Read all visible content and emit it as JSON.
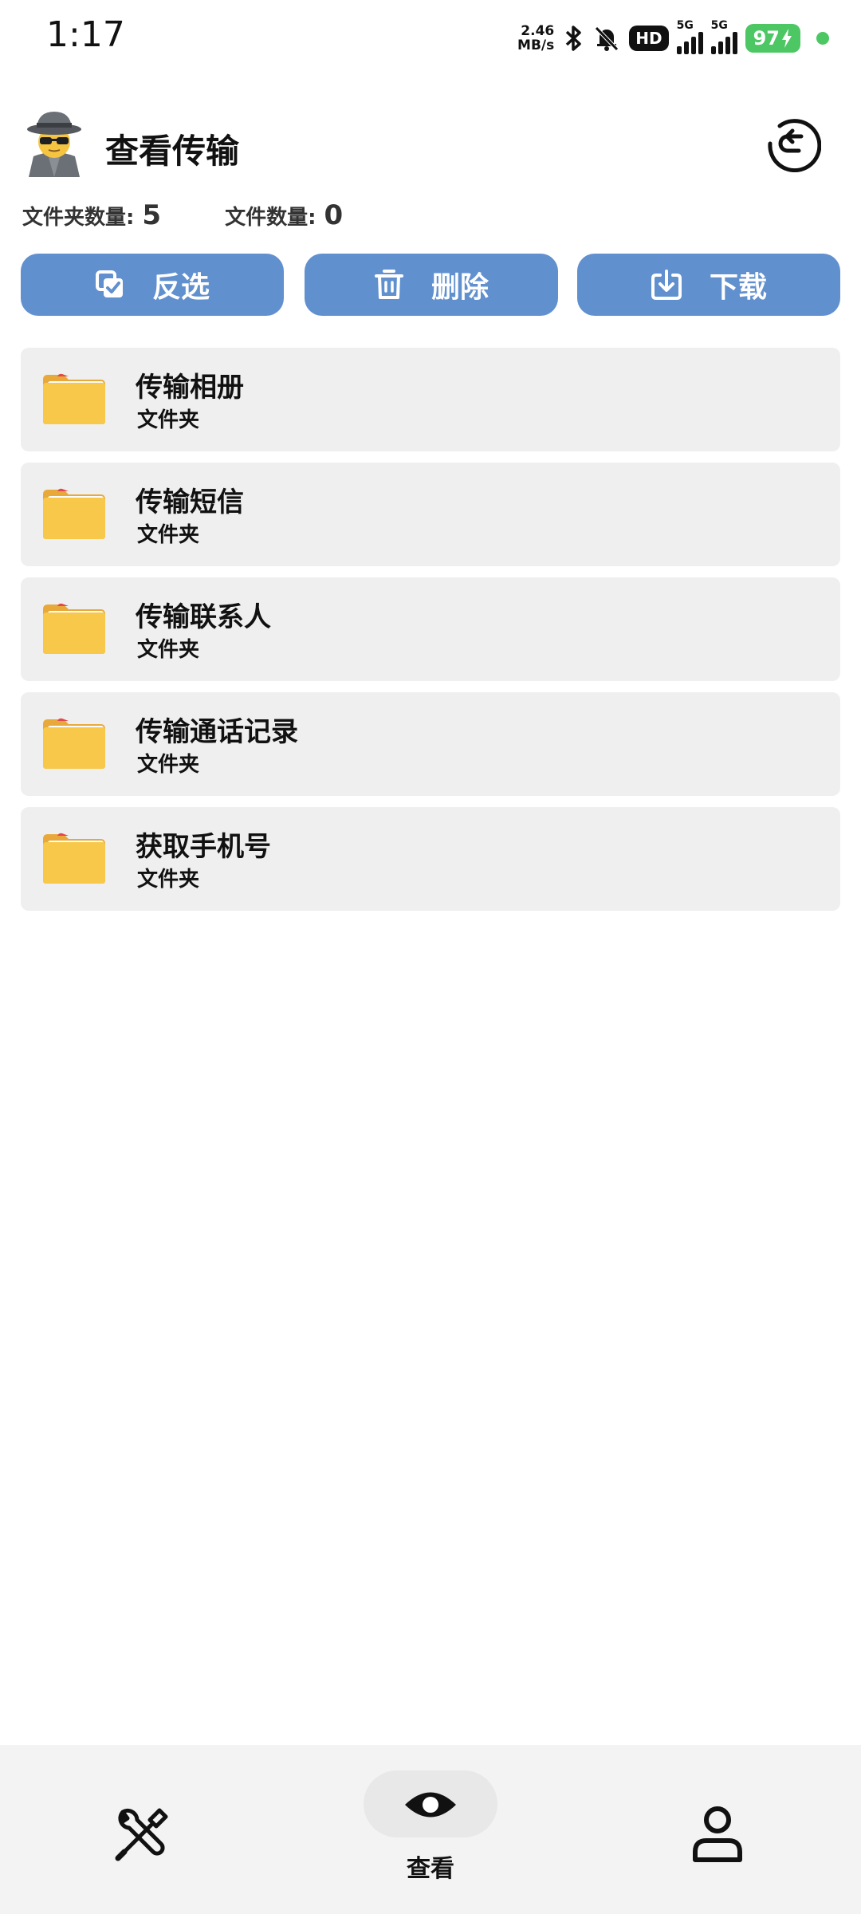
{
  "status_bar": {
    "time": "1:17",
    "net_speed_value": "2.46",
    "net_speed_unit": "MB/s",
    "hd": "HD",
    "sim1_tag": "5G",
    "sim2_tag": "5G",
    "battery": "97",
    "battery_color": "#4cc764"
  },
  "header": {
    "title": "查看传输",
    "avatar_icon": "spy-avatar-icon",
    "refresh_icon": "refresh-icon"
  },
  "counts": {
    "folder_label": "文件夹数量:",
    "folder_value": "5",
    "file_label": "文件数量:",
    "file_value": "0"
  },
  "actions": {
    "invert_label": "反选",
    "delete_label": "删除",
    "download_label": "下载",
    "button_color": "#6190cf"
  },
  "folders": [
    {
      "name": "传输相册",
      "type": "文件夹"
    },
    {
      "name": "传输短信",
      "type": "文件夹"
    },
    {
      "name": "传输联系人",
      "type": "文件夹"
    },
    {
      "name": "传输通话记录",
      "type": "文件夹"
    },
    {
      "name": "获取手机号",
      "type": "文件夹"
    }
  ],
  "bottom_nav": {
    "view_label": "查看",
    "tools_icon": "tools-icon",
    "view_icon": "eye-icon",
    "profile_icon": "user-icon"
  }
}
